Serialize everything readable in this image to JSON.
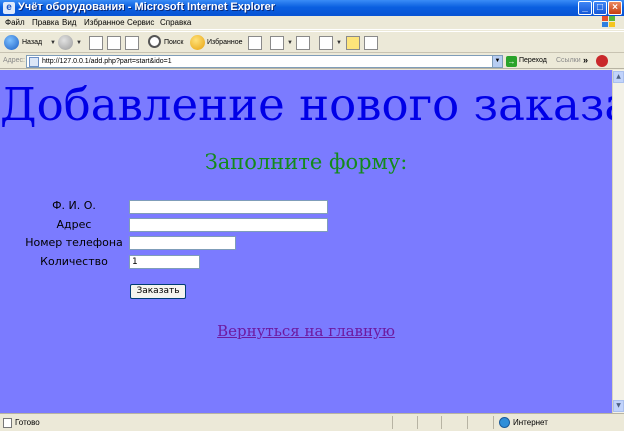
{
  "window": {
    "title": "Учёт оборудования - Microsoft Internet Explorer",
    "app_icon": "e"
  },
  "menu": {
    "items": [
      "Файл",
      "Правка",
      "Вид",
      "Избранное",
      "Сервис",
      "Справка"
    ]
  },
  "toolbar": {
    "back_label": "Назад",
    "search_label": "Поиск",
    "favorites_label": "Избранное"
  },
  "address_bar": {
    "label": "Адрес:",
    "url": "http://127.0.0.1/add.php?part=start&ido=1",
    "go_label": "Переход",
    "links_label": "Ссылки"
  },
  "page": {
    "background": "#7b7bff",
    "title": "Добавление нового заказа",
    "subtitle": "Заполните форму:",
    "form": {
      "fio_label": "Ф. И. О.",
      "fio_value": "",
      "address_label": "Адрес",
      "address_value": "",
      "phone_label": "Номер телефона",
      "phone_value": "",
      "quantity_label": "Количество",
      "quantity_value": "1",
      "submit_label": "Заказать"
    },
    "back_link": "Вернуться на главную"
  },
  "status_bar": {
    "status": "Готово",
    "zone": "Интернет"
  }
}
